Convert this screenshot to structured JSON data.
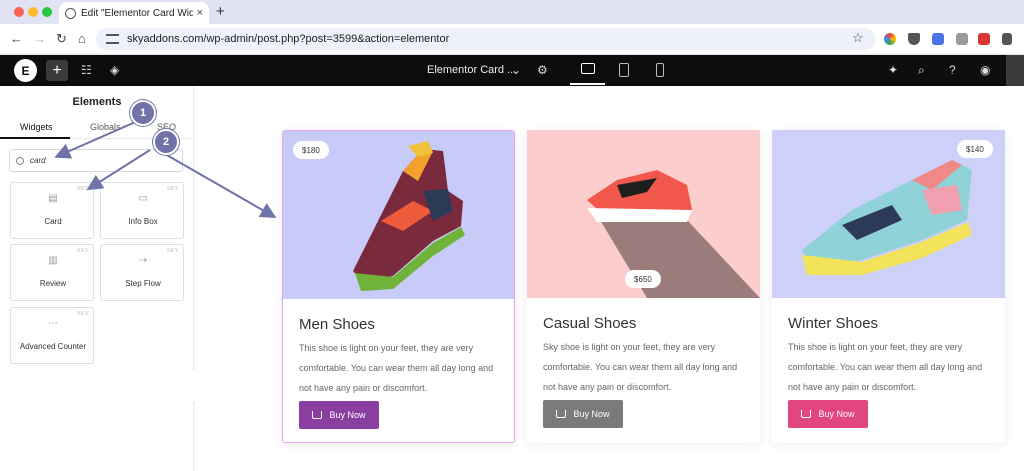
{
  "browser": {
    "tab_title": "Edit \"Elementor Card Widget\"",
    "tab_close": "×",
    "new_tab": "+",
    "url": "skyaddons.com/wp-admin/post.php?post=3599&action=elementor"
  },
  "editor": {
    "logo": "E",
    "add": "+",
    "document_title": "Elementor Card ..."
  },
  "panel": {
    "title": "Elements",
    "tabs": [
      "Widgets",
      "Globals",
      "SEO"
    ],
    "search_value": "card",
    "widgets": [
      {
        "label": "Card",
        "badge": "SKY"
      },
      {
        "label": "Info Box",
        "badge": "SKY"
      },
      {
        "label": "Review",
        "badge": "SKY"
      },
      {
        "label": "Step Flow",
        "badge": "SKY"
      },
      {
        "label": "Advanced Counter",
        "badge": "SKY"
      }
    ]
  },
  "cards": [
    {
      "price": "$180",
      "title": "Men Shoes",
      "description": "This shoe is light on your feet, they are very comfortable. You can wear them all day long and not have any pain or discomfort.",
      "button": "Buy Now",
      "image_bg": "#c8cbf7",
      "button_color": "#8a3ea0"
    },
    {
      "price": "$650",
      "title": "Casual Shoes",
      "description": "Sky shoe is light on your feet, they are very comfortable. You can wear them all day long and not have any pain or discomfort.",
      "button": "Buy Now",
      "image_bg": "#fbcdcd",
      "button_color": "#7a7a7a"
    },
    {
      "price": "$140",
      "title": "Winter Shoes",
      "description": "This shoe is light on your feet, they are very comfortable. You can wear them all day long and not have any pain or discomfort.",
      "button": "Buy Now",
      "image_bg": "#cdd0f8",
      "button_color": "#e0457f"
    }
  ],
  "callouts": [
    "1",
    "2"
  ]
}
